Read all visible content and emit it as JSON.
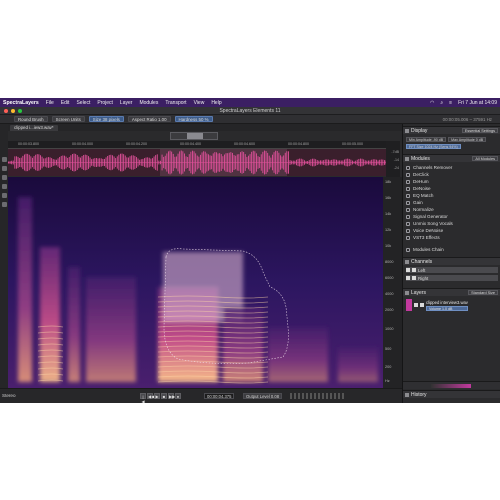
{
  "menubar": {
    "app": "SpectraLayers",
    "items": [
      "File",
      "Edit",
      "Select",
      "Project",
      "Layer",
      "Modules",
      "Transport",
      "View",
      "Help"
    ],
    "datetime": "Fri 7 Jun at 14:09"
  },
  "window": {
    "title": "SpectraLayers Elements 11"
  },
  "toolbar": {
    "brush": "Round Brush",
    "units": "Screen Units",
    "size": "Size 38 pixels",
    "aspect": "Aspect Ratio 1.00",
    "hardness": "Hardness 50 %",
    "time": "00:00:05.006 – 37591 Hz"
  },
  "document": {
    "tab": "clipped i...iew3.wav*"
  },
  "timeline": {
    "ticks": [
      "00:00:03.800",
      "00:00:04.000",
      "00:00:04.200",
      "00:00:04.400",
      "00:00:04.600",
      "00:00:04.800",
      "00:00:05.000"
    ],
    "right_ticks": [
      "-7dB",
      "-14",
      "-24"
    ]
  },
  "freq_labels": [
    "18k",
    "16k",
    "14k",
    "12k",
    "10k",
    "8000",
    "6000",
    "4000",
    "2000",
    "1000",
    "500",
    "200",
    "Hz"
  ],
  "status": {
    "channels": "Stereo",
    "time": "00:00:04.375",
    "output_level": "Output Level 0.08",
    "transport": [
      "|◀",
      "◀◀",
      "▶",
      "■",
      "▶▶",
      "●"
    ]
  },
  "panels": {
    "display": {
      "title": "Display",
      "dropdown": "Essential Settings",
      "row1": [
        "Min Amplitude -90 dB",
        "Max Amplitude 0 dB"
      ],
      "row2": [
        "FFT Size 1024 Hz (Sens 94%)"
      ]
    },
    "modules": {
      "title": "Modules",
      "dropdown": "All Modules",
      "items": [
        "Channels Remover",
        "DeClick",
        "DeHum",
        "DeNoise",
        "EQ Match",
        "Gain",
        "Normalize",
        "Signal Generator",
        "Unmix Song Vocals",
        "Voice DeNoise",
        "VST3 Effects"
      ],
      "chain": "Modules Chain"
    },
    "channels": {
      "title": "Channels",
      "items": [
        "Left",
        "Right"
      ]
    },
    "layers": {
      "title": "Layers",
      "dropdown": "Standard Size",
      "file": "clipped interview3.wav",
      "volume": "Volume 1.0 dB"
    },
    "history": {
      "title": "History"
    }
  },
  "colors": {
    "menubar": "#3b1f63",
    "spectrogram_low": "#1a0a3c",
    "spectrogram_high": "#ffc38a",
    "waveform": "#e0509a"
  }
}
